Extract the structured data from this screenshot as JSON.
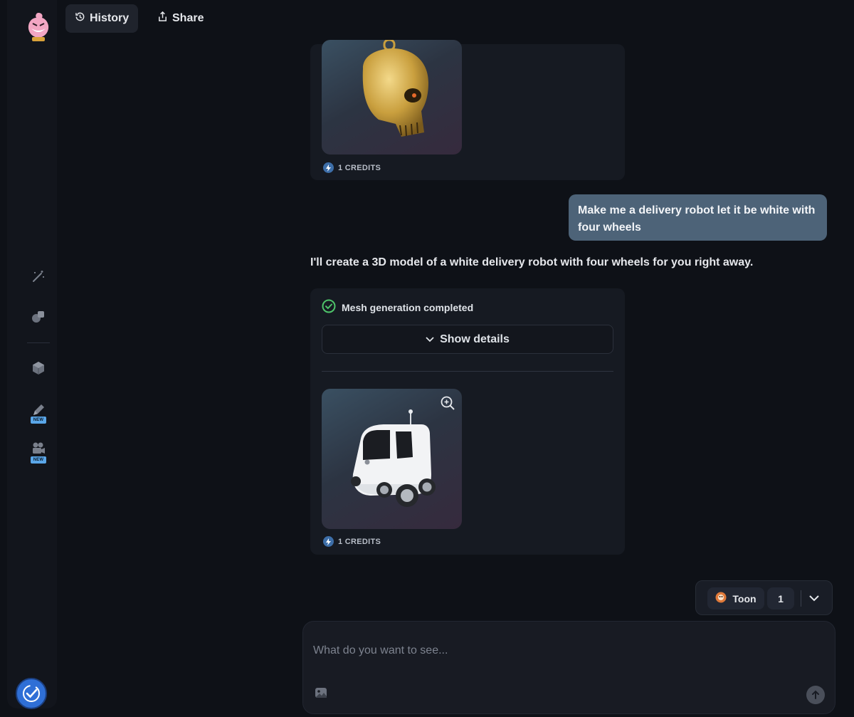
{
  "topbar": {
    "history_label": "History",
    "share_label": "Share"
  },
  "sidebar": {
    "items": [
      {
        "name": "magic-wand",
        "badge": ""
      },
      {
        "name": "shapes",
        "badge": ""
      },
      {
        "name": "cube",
        "badge": ""
      },
      {
        "name": "pencil",
        "badge": "NEW"
      },
      {
        "name": "video-camera",
        "badge": "NEW"
      }
    ]
  },
  "chat": {
    "previous_result": {
      "credits": "1 CREDITS"
    },
    "user_message": "Make me a delivery robot let it be white with four wheels",
    "assistant_message": "I'll create a 3D model of a white delivery robot with four wheels for you right away.",
    "status": "Mesh generation completed",
    "details_label": "Show details",
    "result": {
      "credits": "1 CREDITS"
    }
  },
  "model_bar": {
    "style_label": "Toon",
    "count": "1"
  },
  "prompt": {
    "placeholder": "What do you want to see..."
  },
  "colors": {
    "background": "#0e1117",
    "accent": "#4d6378",
    "success": "#4ec46a",
    "badge": "#5aa6e8"
  }
}
